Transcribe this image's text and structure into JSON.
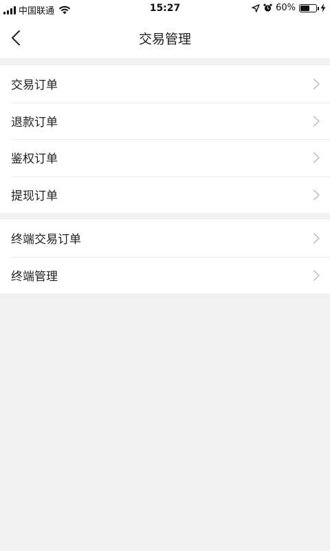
{
  "status_bar": {
    "carrier": "中国联通",
    "time": "15:27",
    "battery_percent_label": "60%",
    "battery_level": 0.6
  },
  "nav": {
    "title": "交易管理",
    "back_icon": "chevron-left-icon"
  },
  "groups": [
    {
      "items": [
        {
          "label": "交易订单"
        },
        {
          "label": "退款订单"
        },
        {
          "label": "鉴权订单"
        },
        {
          "label": "提现订单"
        }
      ]
    },
    {
      "items": [
        {
          "label": "终端交易订单"
        },
        {
          "label": "终端管理"
        }
      ]
    }
  ],
  "colors": {
    "background": "#f2f2f2",
    "surface": "#ffffff",
    "text": "#222222",
    "chevron": "#b8b8b8"
  }
}
